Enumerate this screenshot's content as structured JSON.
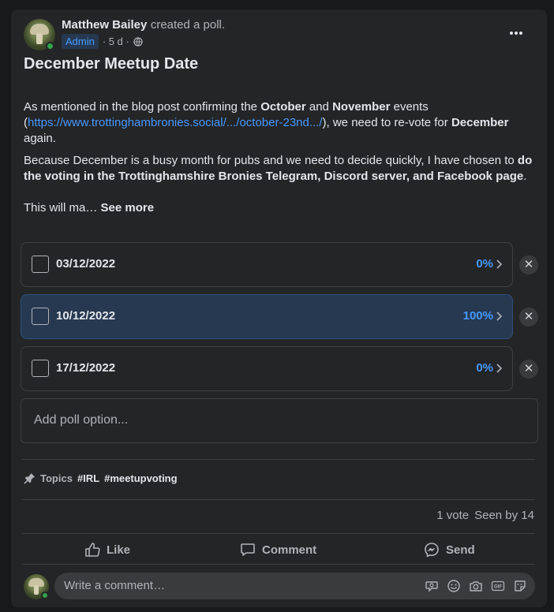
{
  "post": {
    "author": "Matthew Bailey",
    "action": "created a poll.",
    "badge": "Admin",
    "time": "· 5 d ·",
    "title": "December Meetup Date",
    "para1": {
      "t1": "As mentioned in the blog post confirming the ",
      "b1": "October",
      "t2": " and ",
      "b2": "November",
      "t3": " events",
      "open_paren": "(",
      "link": "https://www.trottinghambronies.social/.../october-23nd.../",
      "t4": "), we need to re-vote for ",
      "b3": "December",
      "t5": "again."
    },
    "para2": {
      "t1": "Because December is a busy month for pubs and we need to decide quickly, I have chosen to ",
      "b1": "do the voting in the Trottinghamshire Bronies Telegram, Discord server, and Facebook page",
      "t2": "."
    },
    "para3": {
      "t1": "This will ma… ",
      "see_more": "See more"
    }
  },
  "poll": {
    "options": [
      {
        "label": "03/12/2022",
        "percent": "0%",
        "selected": false,
        "remove": "✕"
      },
      {
        "label": "10/12/2022",
        "percent": "100%",
        "selected": true,
        "remove": "✕"
      },
      {
        "label": "17/12/2022",
        "percent": "0%",
        "selected": false,
        "remove": "✕"
      }
    ],
    "add_placeholder": "Add poll option..."
  },
  "topics": {
    "label": "Topics",
    "tags": [
      "#IRL",
      "#meetupvoting"
    ]
  },
  "stats": {
    "votes": "1 vote",
    "seen": "Seen by 14"
  },
  "actions": {
    "like": "Like",
    "comment": "Comment",
    "send": "Send"
  },
  "comment": {
    "placeholder": "Write a comment…"
  },
  "colors": {
    "accent": "#4599ff",
    "selected_option_bg": "#263951",
    "card_bg": "#242526",
    "page_bg": "#18191a"
  },
  "icons": [
    "more-options-icon",
    "globe-icon",
    "chevron-right-icon",
    "close-icon",
    "pin-icon",
    "like-icon",
    "comment-icon",
    "messenger-icon",
    "avatar-sticker-icon",
    "emoji-icon",
    "camera-icon",
    "gif-icon",
    "sticker-icon"
  ]
}
